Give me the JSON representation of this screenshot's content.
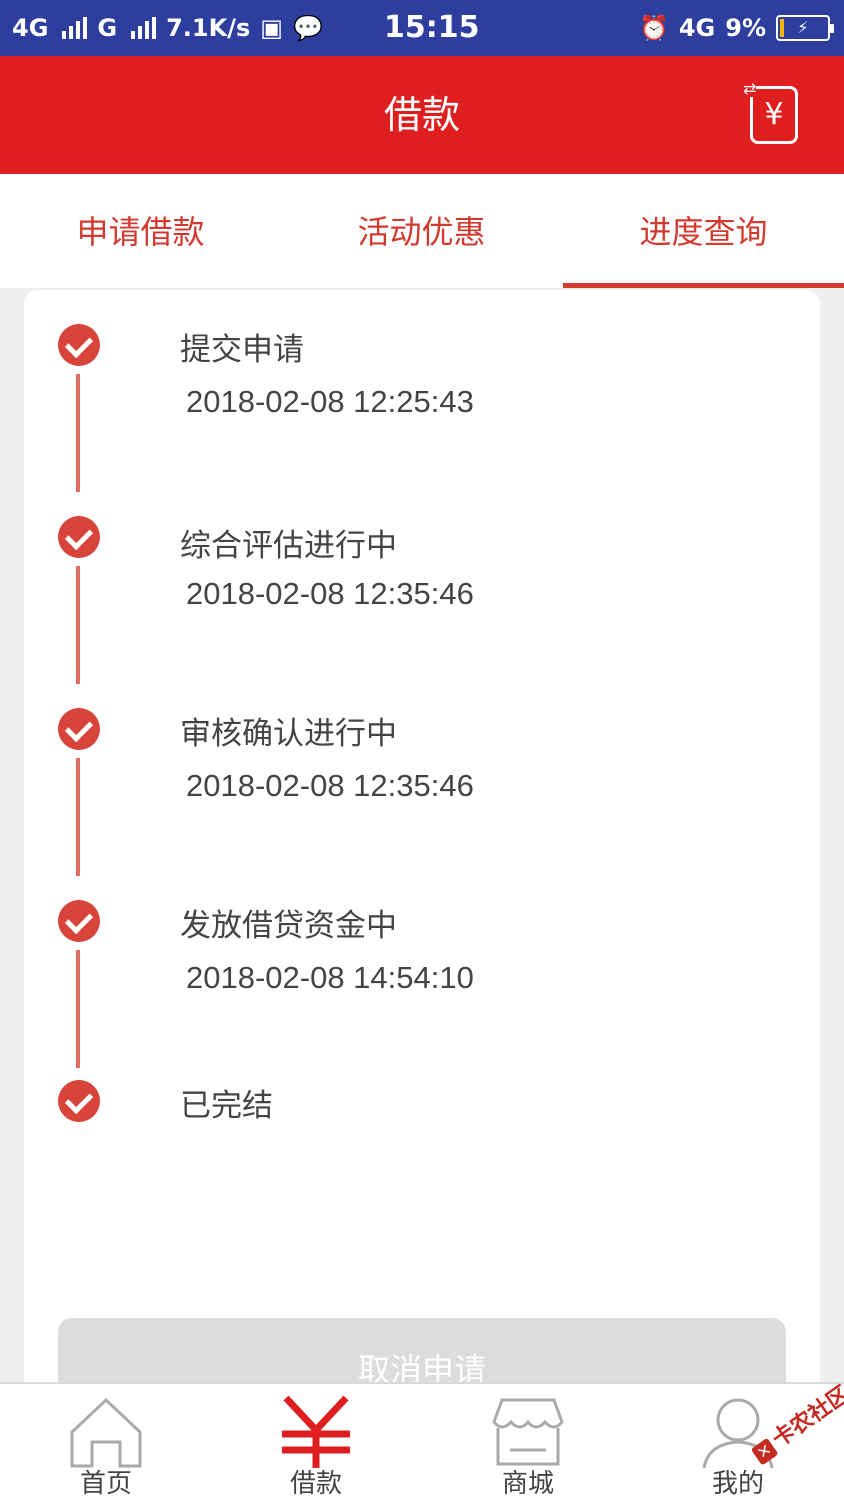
{
  "status_bar": {
    "network1": "4G",
    "network2": "G",
    "speed": "7.1K/s",
    "time": "15:15",
    "network3": "4G",
    "battery": "9%"
  },
  "header": {
    "title": "借款",
    "action_icon": "yuan-exchange-icon",
    "action_symbol": "¥"
  },
  "tabs": [
    {
      "label": "申请借款"
    },
    {
      "label": "活动优惠"
    },
    {
      "label": "进度查询",
      "active": true
    }
  ],
  "progress": {
    "steps": [
      {
        "title": "提交申请",
        "time": "2018-02-08 12:25:43"
      },
      {
        "title": "综合评估进行中",
        "time": "2018-02-08 12:35:46"
      },
      {
        "title": "审核确认进行中",
        "time": "2018-02-08 12:35:46"
      },
      {
        "title": "发放借贷资金中",
        "time": "2018-02-08 14:54:10"
      },
      {
        "title": "已完结"
      }
    ],
    "cancel_label": "取消申请"
  },
  "bottom_nav": [
    {
      "label": "首页",
      "icon": "home-icon"
    },
    {
      "label": "借款",
      "icon": "yuan-icon",
      "active": true
    },
    {
      "label": "商城",
      "icon": "store-icon"
    },
    {
      "label": "我的",
      "icon": "user-icon"
    }
  ],
  "watermark": "卡农社区",
  "colors": {
    "status_bar": "#2d3e9e",
    "header": "#df1f1f",
    "accent": "#d23a2f",
    "check": "#d8443a"
  }
}
